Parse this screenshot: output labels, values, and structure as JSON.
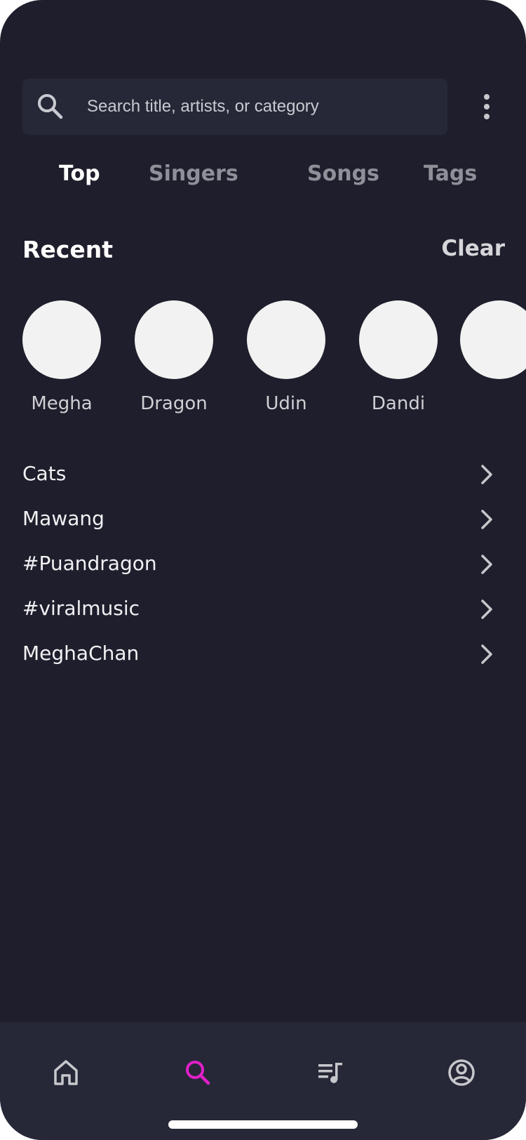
{
  "search": {
    "placeholder": "Search title, artists, or category",
    "value": ""
  },
  "tabs": [
    {
      "label": "Top",
      "active": true
    },
    {
      "label": "Singers",
      "active": false
    },
    {
      "label": "Songs",
      "active": false
    },
    {
      "label": "Tags",
      "active": false
    }
  ],
  "recent": {
    "title": "Recent",
    "clear_label": "Clear",
    "items": [
      {
        "name": "Megha"
      },
      {
        "name": "Dragon"
      },
      {
        "name": "Udin"
      },
      {
        "name": "Dandi"
      },
      {
        "name": ""
      }
    ]
  },
  "history": [
    {
      "label": "Cats"
    },
    {
      "label": "Mawang"
    },
    {
      "label": "#Puandragon"
    },
    {
      "label": "#viralmusic"
    },
    {
      "label": "MeghaChan"
    }
  ],
  "nav": {
    "items": [
      {
        "icon": "home-icon",
        "active": false
      },
      {
        "icon": "search-icon",
        "active": true
      },
      {
        "icon": "playlist-icon",
        "active": false
      },
      {
        "icon": "profile-icon",
        "active": false
      }
    ]
  },
  "colors": {
    "background": "#1f1e2c",
    "surface": "#262838",
    "accent": "#e020c8",
    "inactive_text": "#8e8f99"
  }
}
